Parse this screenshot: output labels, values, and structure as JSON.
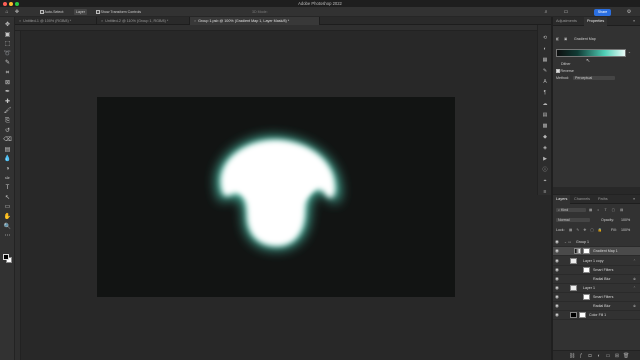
{
  "window": {
    "title": "Adobe Photoshop 2022"
  },
  "options": {
    "auto_select_label": "Auto-Select:",
    "auto_select_value": "Layer",
    "transform_label": "Show Transform Controls",
    "mode_3d": "3D Mode:",
    "share_label": "Share"
  },
  "tabs": [
    {
      "label": "Untitled-1 @ 100% (RGB/8) *"
    },
    {
      "label": "Untitled-2 @ 110% (Group 1, RGB/8) *"
    },
    {
      "label": "Group 1.psb @ 100% (Gradient Map 1, Layer Mask/8) *"
    }
  ],
  "properties_panel": {
    "tab_adjustments": "Adjustments",
    "tab_properties": "Properties",
    "heading": "Gradient Map",
    "dither_label": "Dither",
    "reverse_label": "Reverse",
    "method_label": "Method:",
    "method_value": "Perceptual",
    "gradient_colors": [
      "#0e0f0f",
      "#103a34",
      "#4fcfb6",
      "#e9fbf7"
    ]
  },
  "layers_panel": {
    "tab_layers": "Layers",
    "tab_channels": "Channels",
    "tab_paths": "Paths",
    "filter_kind": "Kind",
    "blend_mode": "Normal",
    "opacity_label": "Opacity:",
    "opacity_value": "100%",
    "lock_label": "Lock:",
    "fill_label": "Fill:",
    "fill_value": "100%",
    "layers": [
      {
        "name": "Group 1",
        "kind": "group"
      },
      {
        "name": "Gradient Map 1",
        "kind": "adjustment"
      },
      {
        "name": "Layer 1 copy",
        "kind": "smart-object"
      },
      {
        "name": "Smart Filters",
        "kind": "smart-filter"
      },
      {
        "name": "Radial Blur",
        "kind": "filter"
      },
      {
        "name": "Layer 1",
        "kind": "smart-object"
      },
      {
        "name": "Smart Filters",
        "kind": "smart-filter"
      },
      {
        "name": "Radial Blur",
        "kind": "filter"
      },
      {
        "name": "Color Fill 1",
        "kind": "fill"
      }
    ]
  },
  "tools": [
    "move-tool",
    "artboard-tool",
    "marquee-tool",
    "lasso-tool",
    "quick-select-tool",
    "crop-tool",
    "frame-tool",
    "eyedropper-tool",
    "healing-tool",
    "brush-tool",
    "clone-stamp-tool",
    "history-brush-tool",
    "eraser-tool",
    "gradient-tool",
    "blur-tool",
    "dodge-tool",
    "pen-tool",
    "type-tool",
    "path-select-tool",
    "shape-tool",
    "hand-tool",
    "zoom-tool",
    "more-tools"
  ],
  "colors": {
    "accent": "#2b6fe0",
    "teal_glow": "#4fcfb6"
  }
}
